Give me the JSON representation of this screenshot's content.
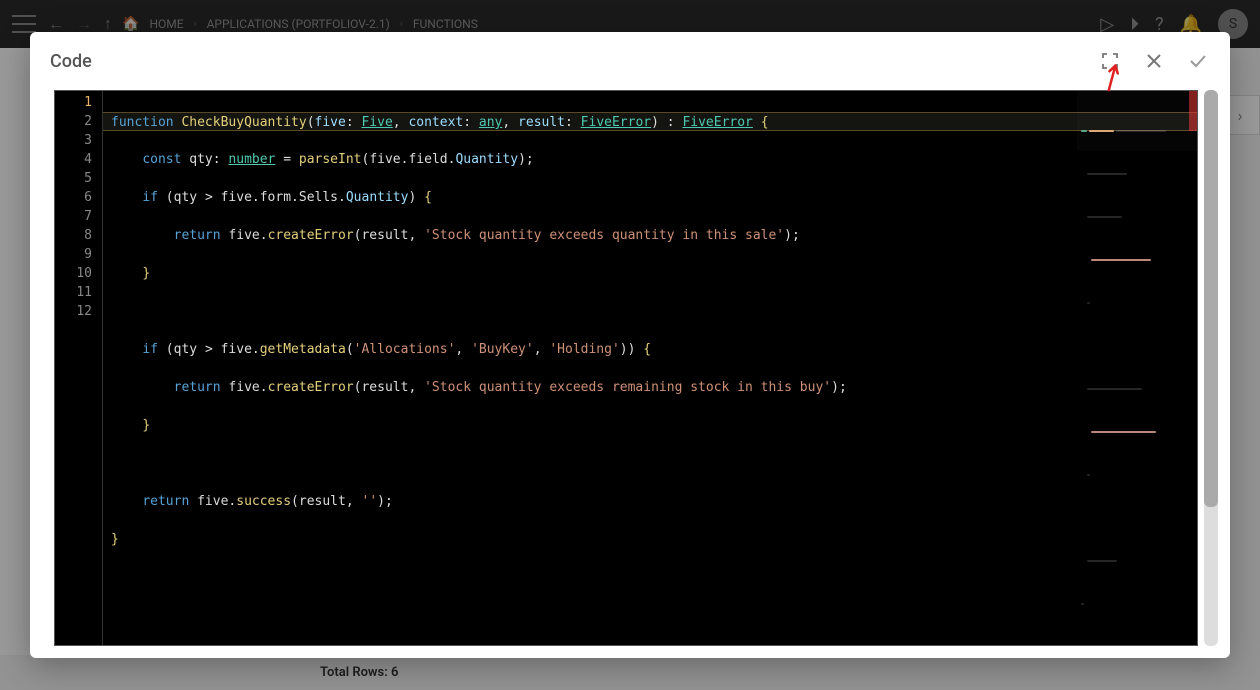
{
  "bg": {
    "breadcrumb": {
      "home": "HOME",
      "applications": "APPLICATIONS (PORTFOLIOV-2.1)",
      "functions": "FUNCTIONS"
    },
    "avatar": "S",
    "totalRows": "Total Rows: 6"
  },
  "modal": {
    "title": "Code"
  },
  "code": {
    "lines": [
      1,
      2,
      3,
      4,
      5,
      6,
      7,
      8,
      9,
      10,
      11,
      12
    ],
    "tokens": {
      "function": "function",
      "funcName": "CheckBuyQuantity",
      "p1": "five",
      "t1": "Five",
      "p2": "context",
      "t2": "any",
      "p3": "result",
      "t3": "FiveError",
      "retType": "FiveError",
      "const": "const",
      "qty": "qty",
      "numberType": "number",
      "parseInt": "parseInt",
      "fiveObj": "five",
      "field": "field",
      "Quantity": "Quantity",
      "if": "if",
      "form": "form",
      "Sells": "Sells",
      "return": "return",
      "createError": "createError",
      "resultVar": "result",
      "str1": "'Stock quantity exceeds quantity in this sale'",
      "getMetadata": "getMetadata",
      "allocations": "'Allocations'",
      "buyKey": "'BuyKey'",
      "holding": "'Holding'",
      "str2": "'Stock quantity exceeds remaining stock in this buy'",
      "success": "success",
      "emptyStr": "''"
    }
  }
}
